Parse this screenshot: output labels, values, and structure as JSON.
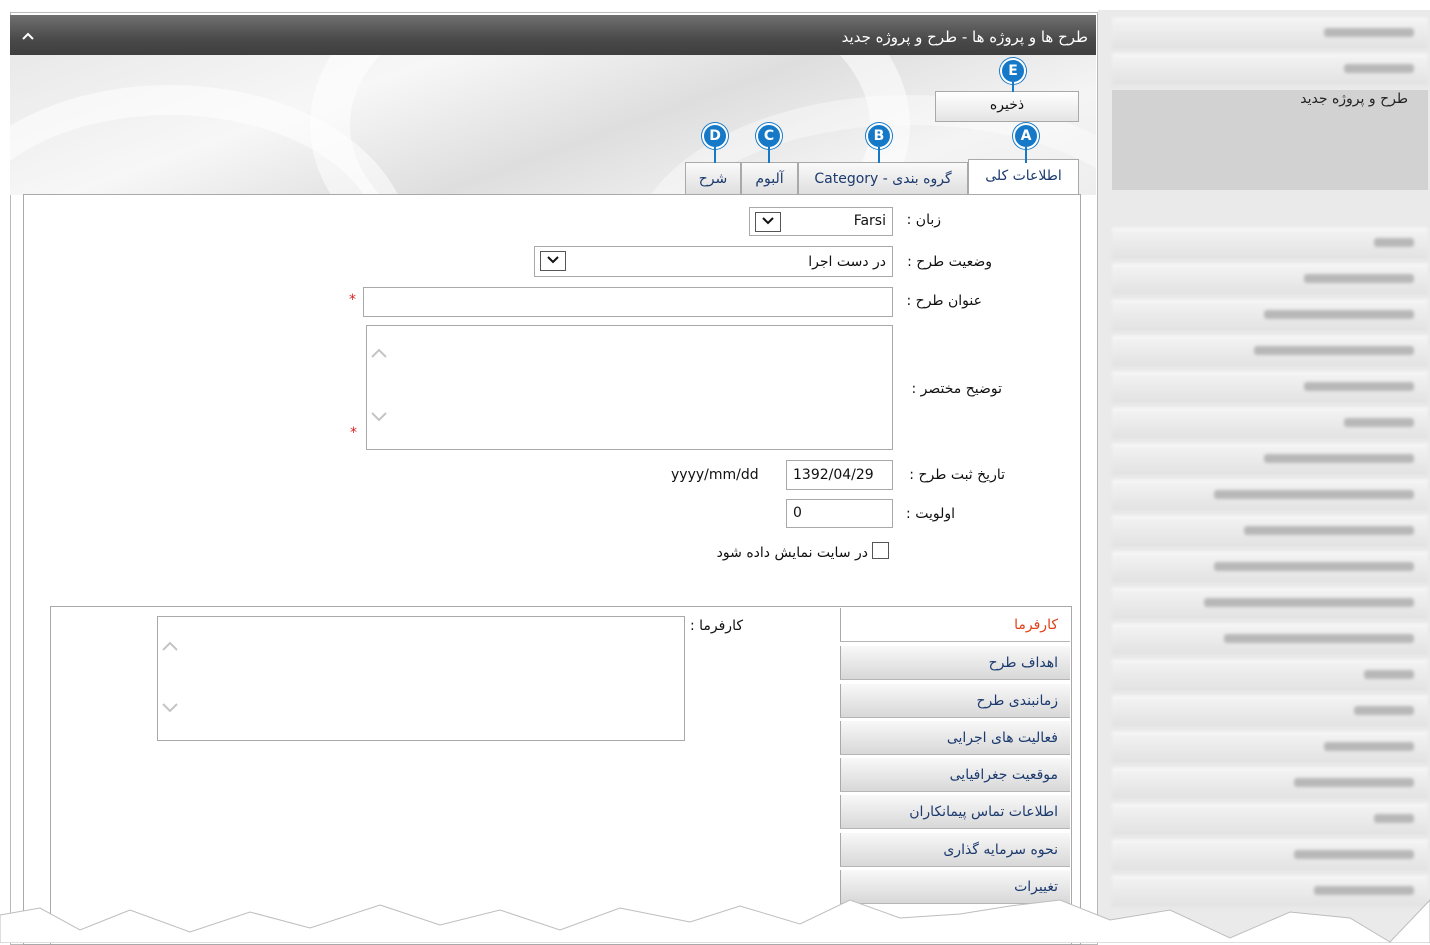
{
  "window": {
    "title": "طرح ها و پروژه ها - طرح و پروژه جدید",
    "collapse_icon": "chevron-up-icon"
  },
  "toolbar": {
    "save_label": "ذخیره"
  },
  "callouts": {
    "a": "A",
    "b": "B",
    "c": "C",
    "d": "D",
    "e": "E"
  },
  "tabs": [
    {
      "label": "اطلاعات کلی",
      "active": true
    },
    {
      "label": "گروه بندی - Category",
      "active": false
    },
    {
      "label": "آلبوم",
      "active": false
    },
    {
      "label": "شرح",
      "active": false
    }
  ],
  "form": {
    "language": {
      "label": "زبان :",
      "value": "Farsi"
    },
    "status": {
      "label": "وضعیت طرح :",
      "value": "در دست اجرا"
    },
    "title": {
      "label": "عنوان طرح :",
      "value": "",
      "required_mark": "*"
    },
    "summary": {
      "label": "توضیح مختصر :",
      "value": "",
      "required_mark": "*"
    },
    "date": {
      "label": "تاریخ ثبت طرح :",
      "value": "1392/04/29",
      "format_hint": "yyyy/mm/dd"
    },
    "priority": {
      "label": "اولویت :",
      "value": "0"
    },
    "show_on_site": {
      "label": "در سایت نمایش داده شود",
      "checked": false
    }
  },
  "detail_tabs": [
    {
      "label": "کارفرما",
      "active": true
    },
    {
      "label": "اهداف طرح",
      "active": false
    },
    {
      "label": "زمانبندی طرح",
      "active": false
    },
    {
      "label": "فعالیت های اجرایی",
      "active": false
    },
    {
      "label": "موقعیت جغرافیایی",
      "active": false
    },
    {
      "label": "اطلاعات تماس پیمانکاران",
      "active": false
    },
    {
      "label": "نحوه سرمایه گذاری",
      "active": false
    },
    {
      "label": "تغییرات",
      "active": false
    }
  ],
  "detail_panel": {
    "employer_label": "کارفرما :",
    "employer_value": ""
  },
  "sidebar": {
    "active_item": "طرح و پروژه جدید"
  },
  "colors": {
    "callout": "#1679c8",
    "titlebar": "#4a4a4a",
    "link": "#1b3a6e",
    "active_detail_tab": "#e0401a",
    "required": "#e02020"
  }
}
